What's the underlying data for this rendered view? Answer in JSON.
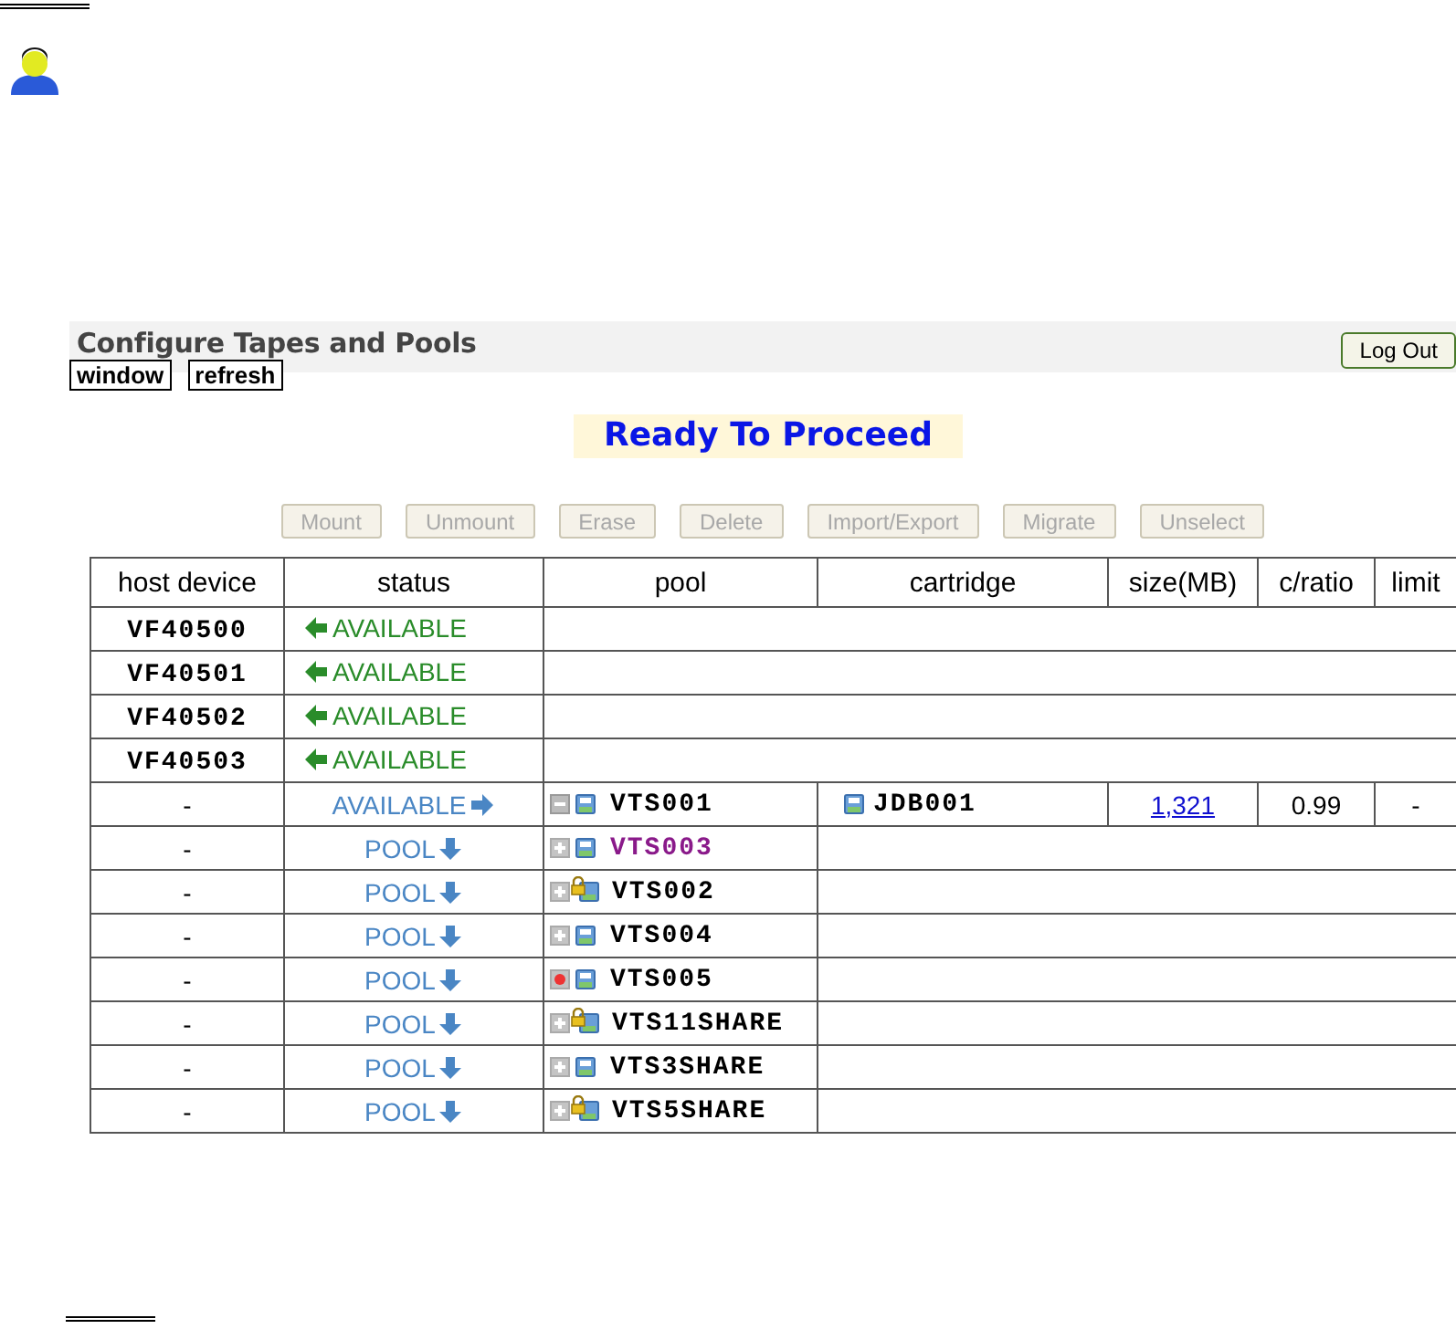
{
  "header": {
    "title": "Configure Tapes and Pools",
    "logout": "Log Out",
    "links": [
      "window",
      "refresh"
    ]
  },
  "banner": "Ready To Proceed",
  "actions": [
    {
      "label": "Mount",
      "disabled": true
    },
    {
      "label": "Unmount",
      "disabled": true
    },
    {
      "label": "Erase",
      "disabled": true
    },
    {
      "label": "Delete",
      "disabled": true
    },
    {
      "label": "Import/Export",
      "disabled": true
    },
    {
      "label": "Migrate",
      "disabled": true
    },
    {
      "label": "Unselect",
      "disabled": true
    }
  ],
  "table": {
    "columns": [
      "host device",
      "status",
      "pool",
      "cartridge",
      "size(MB)",
      "c/ratio",
      "limit"
    ],
    "rows": [
      {
        "host": "VF40500",
        "status": "AVAILABLE",
        "kind": "in"
      },
      {
        "host": "VF40501",
        "status": "AVAILABLE",
        "kind": "in"
      },
      {
        "host": "VF40502",
        "status": "AVAILABLE",
        "kind": "in"
      },
      {
        "host": "VF40503",
        "status": "AVAILABLE",
        "kind": "in"
      },
      {
        "host": "-",
        "status": "AVAILABLE",
        "kind": "out",
        "pool": {
          "name": "VTS001",
          "kind": "collapse",
          "locked": false,
          "visited": false
        },
        "cartridge": "JDB001",
        "size": "1,321",
        "ratio": "0.99",
        "limit": "-"
      },
      {
        "host": "-",
        "status": "POOL",
        "kind": "pool",
        "pool": {
          "name": "VTS003",
          "kind": "expand",
          "locked": false,
          "visited": true
        }
      },
      {
        "host": "-",
        "status": "POOL",
        "kind": "pool",
        "pool": {
          "name": "VTS002",
          "kind": "expand",
          "locked": true,
          "visited": false
        }
      },
      {
        "host": "-",
        "status": "POOL",
        "kind": "pool",
        "pool": {
          "name": "VTS004",
          "kind": "expand",
          "locked": false,
          "visited": false
        }
      },
      {
        "host": "-",
        "status": "POOL",
        "kind": "pool",
        "pool": {
          "name": "VTS005",
          "kind": "error",
          "locked": false,
          "visited": false
        }
      },
      {
        "host": "-",
        "status": "POOL",
        "kind": "pool",
        "pool": {
          "name": "VTS11SHARE",
          "kind": "expand",
          "locked": true,
          "visited": false
        }
      },
      {
        "host": "-",
        "status": "POOL",
        "kind": "pool",
        "pool": {
          "name": "VTS3SHARE",
          "kind": "expand",
          "locked": false,
          "visited": false
        }
      },
      {
        "host": "-",
        "status": "POOL",
        "kind": "pool",
        "pool": {
          "name": "VTS5SHARE",
          "kind": "expand",
          "locked": true,
          "visited": false
        }
      }
    ]
  }
}
